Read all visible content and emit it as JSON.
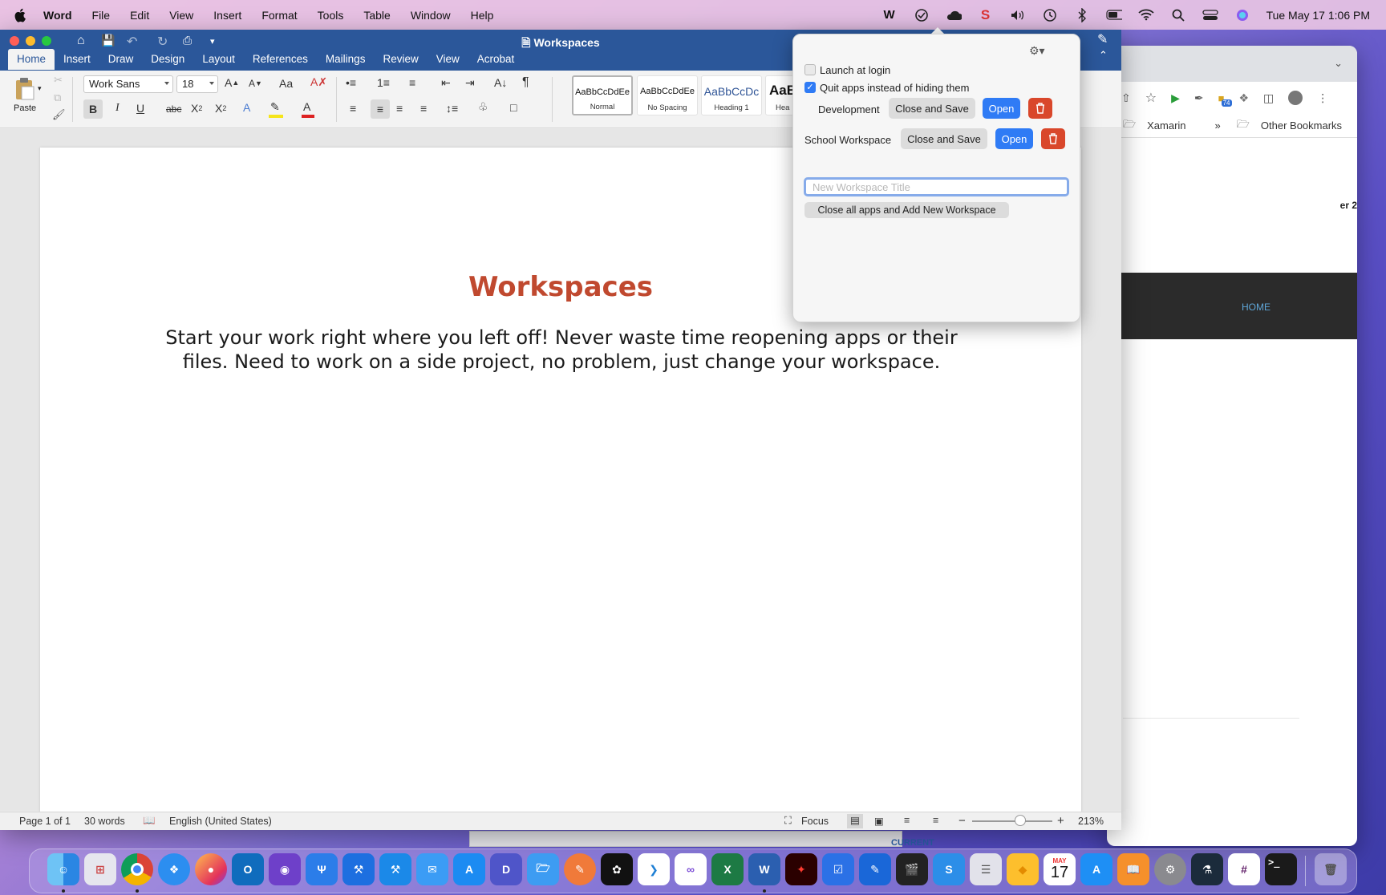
{
  "menubar": {
    "app_name": "Word",
    "items": [
      "File",
      "Edit",
      "View",
      "Insert",
      "Format",
      "Tools",
      "Table",
      "Window",
      "Help"
    ],
    "clock": "Tue May 17  1:06 PM"
  },
  "chrome": {
    "bookmarks": [
      "Xamarin",
      "»",
      "Other Bookmarks"
    ],
    "hero_link": "HOME",
    "side_label": "er 2",
    "extension_badge": "74"
  },
  "behind_strip": {
    "text": "CURRENT"
  },
  "word": {
    "window_title": "Workspaces",
    "tabs": [
      "Home",
      "Insert",
      "Draw",
      "Design",
      "Layout",
      "References",
      "Mailings",
      "Review",
      "View",
      "Acrobat"
    ],
    "active_tab": "Home",
    "share_label": "re",
    "paste_label": "Paste",
    "font_name": "Work Sans",
    "font_size": "18",
    "styles": [
      {
        "sample": "AaBbCcDdEe",
        "name": "Normal"
      },
      {
        "sample": "AaBbCcDdEe",
        "name": "No Spacing"
      },
      {
        "sample": "AaBbCcDc",
        "name": "Heading 1"
      },
      {
        "sample": "AaB",
        "name": "Hea"
      }
    ],
    "document": {
      "heading": "Workspaces",
      "body": "Start your work right where you left off! Never waste time reopening apps or their files. Need to work on a side project, no problem, just change your workspace."
    },
    "status": {
      "page": "Page 1 of 1",
      "words": "30 words",
      "language": "English (United States)",
      "focus": "Focus",
      "zoom": "213%"
    }
  },
  "popover": {
    "launch_at_login_label": "Launch at login",
    "launch_at_login": false,
    "quit_apps_label": "Quit apps instead of hiding them",
    "quit_apps": true,
    "workspaces": [
      {
        "name": "Development",
        "close_label": "Close and Save",
        "open_label": "Open"
      },
      {
        "name": "School Workspace",
        "close_label": "Close and Save",
        "open_label": "Open"
      }
    ],
    "new_title_placeholder": "New Workspace Title",
    "new_title_value": "",
    "add_button_label": "Close all apps and Add New Workspace"
  },
  "dock": {
    "calendar_month": "MAY",
    "calendar_day": "17"
  }
}
